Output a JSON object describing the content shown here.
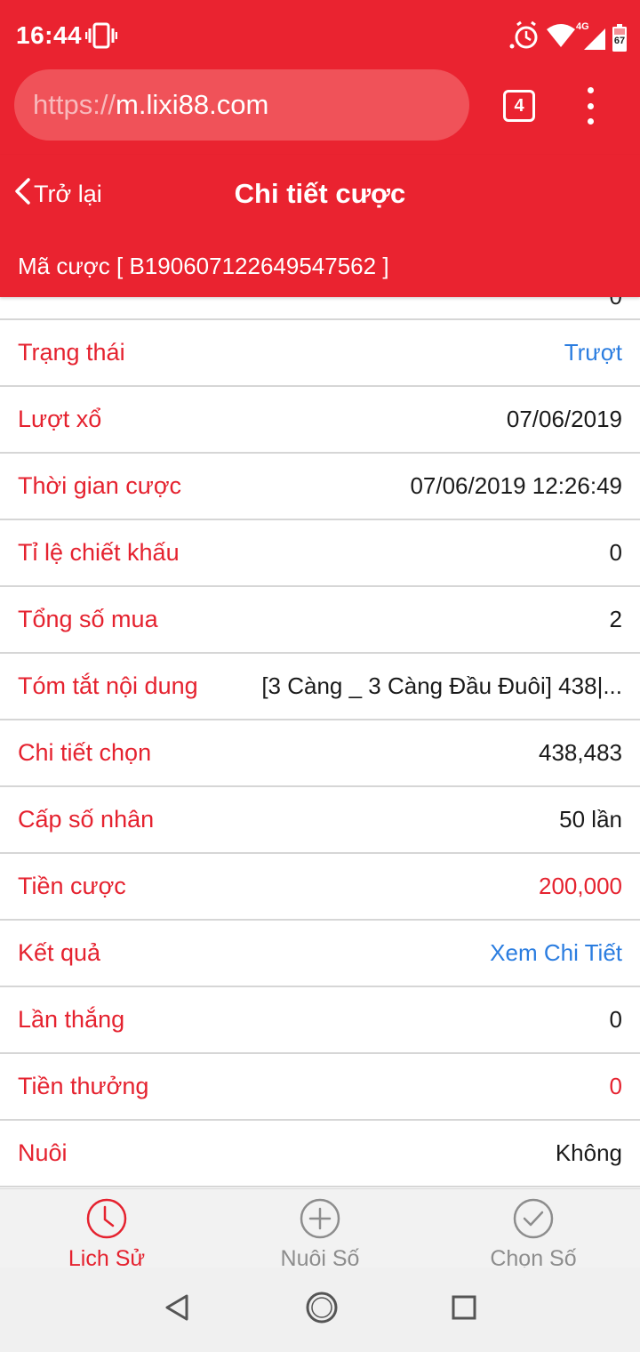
{
  "status_bar": {
    "time": "16:44",
    "network": "4G",
    "battery": "67",
    "icons": [
      "vibrate-icon",
      "alarm-icon",
      "wifi-icon",
      "signal-icon",
      "battery-icon"
    ]
  },
  "browser": {
    "url_scheme": "https://",
    "url_host": "m.lixi88.com",
    "tab_count": "4"
  },
  "header": {
    "back_label": "Trở lại",
    "title": "Chi tiết cược",
    "bet_code": "Mã cược [ B190607122649547562 ]"
  },
  "list": {
    "partial_value": "0",
    "rows": [
      {
        "label": "Trạng thái",
        "value": "Trượt"
      },
      {
        "label": "Lượt xổ",
        "value": "07/06/2019"
      },
      {
        "label": "Thời gian cược",
        "value": "07/06/2019 12:26:49"
      },
      {
        "label": "Tỉ lệ chiết khấu",
        "value": "0"
      },
      {
        "label": "Tổng số mua",
        "value": "2"
      },
      {
        "label": "Tóm tắt nội dung",
        "value": "[3 Càng _ 3 Càng Đầu Đuôi] 438|..."
      },
      {
        "label": "Chi tiết chọn",
        "value": "438,483"
      },
      {
        "label": "Cấp số nhân",
        "value": "50 lần"
      },
      {
        "label": "Tiền cược",
        "value": "200,000"
      },
      {
        "label": "Kết quả",
        "value": "Xem Chi Tiết"
      },
      {
        "label": "Lần thắng",
        "value": "0"
      },
      {
        "label": "Tiền thưởng",
        "value": "0"
      },
      {
        "label": "Nuôi",
        "value": "Không"
      }
    ]
  },
  "bottom_nav": {
    "items": [
      {
        "label": "Lịch Sử",
        "icon": "clock-icon",
        "active": true
      },
      {
        "label": "Nuôi Số",
        "icon": "plus-circle-icon",
        "active": false
      },
      {
        "label": "Chọn Số",
        "icon": "check-circle-icon",
        "active": false
      }
    ]
  },
  "colors": {
    "brand_red": "#ea2330",
    "label_red": "#e5222f",
    "link_blue": "#2b7de0"
  }
}
